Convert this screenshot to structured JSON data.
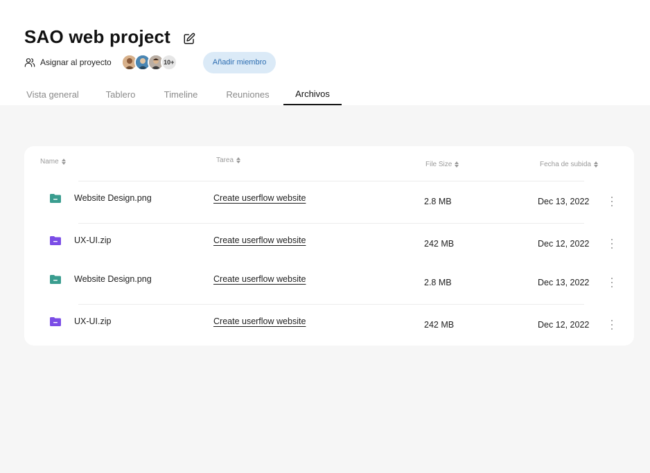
{
  "project": {
    "title": "SAO web project",
    "assign_label": "Asignar al proyecto",
    "extra_members": "10+",
    "add_member_label": "Añadir miembro"
  },
  "tabs": [
    {
      "label": "Vista general",
      "active": false
    },
    {
      "label": "Tablero",
      "active": false
    },
    {
      "label": "Timeline",
      "active": false
    },
    {
      "label": "Reuniones",
      "active": false
    },
    {
      "label": "Archivos",
      "active": true
    }
  ],
  "table": {
    "headers": {
      "name": "Name",
      "task": "Tarea",
      "size": "File Size",
      "date": "Fecha de subida"
    },
    "rows": [
      {
        "name": "Website Design.png",
        "folder_color": "#3a9d8f",
        "task": "Create userflow website",
        "size": "2.8 MB",
        "date": "Dec 13, 2022"
      },
      {
        "name": "UX-UI.zip",
        "folder_color": "#7b4de6",
        "task": "Create userflow website",
        "size": "242 MB",
        "date": "Dec 12, 2022"
      },
      {
        "name": "Website Design.png",
        "folder_color": "#3a9d8f",
        "task": "Create userflow website",
        "size": "2.8 MB",
        "date": "Dec 13, 2022"
      },
      {
        "name": "UX-UI.zip",
        "folder_color": "#7b4de6",
        "task": "Create userflow website",
        "size": "242 MB",
        "date": "Dec 12, 2022"
      }
    ]
  },
  "colors": {
    "accent_button_bg": "#dbeaf7",
    "accent_button_text": "#2b6cb0",
    "content_bg": "#f6f6f6"
  }
}
